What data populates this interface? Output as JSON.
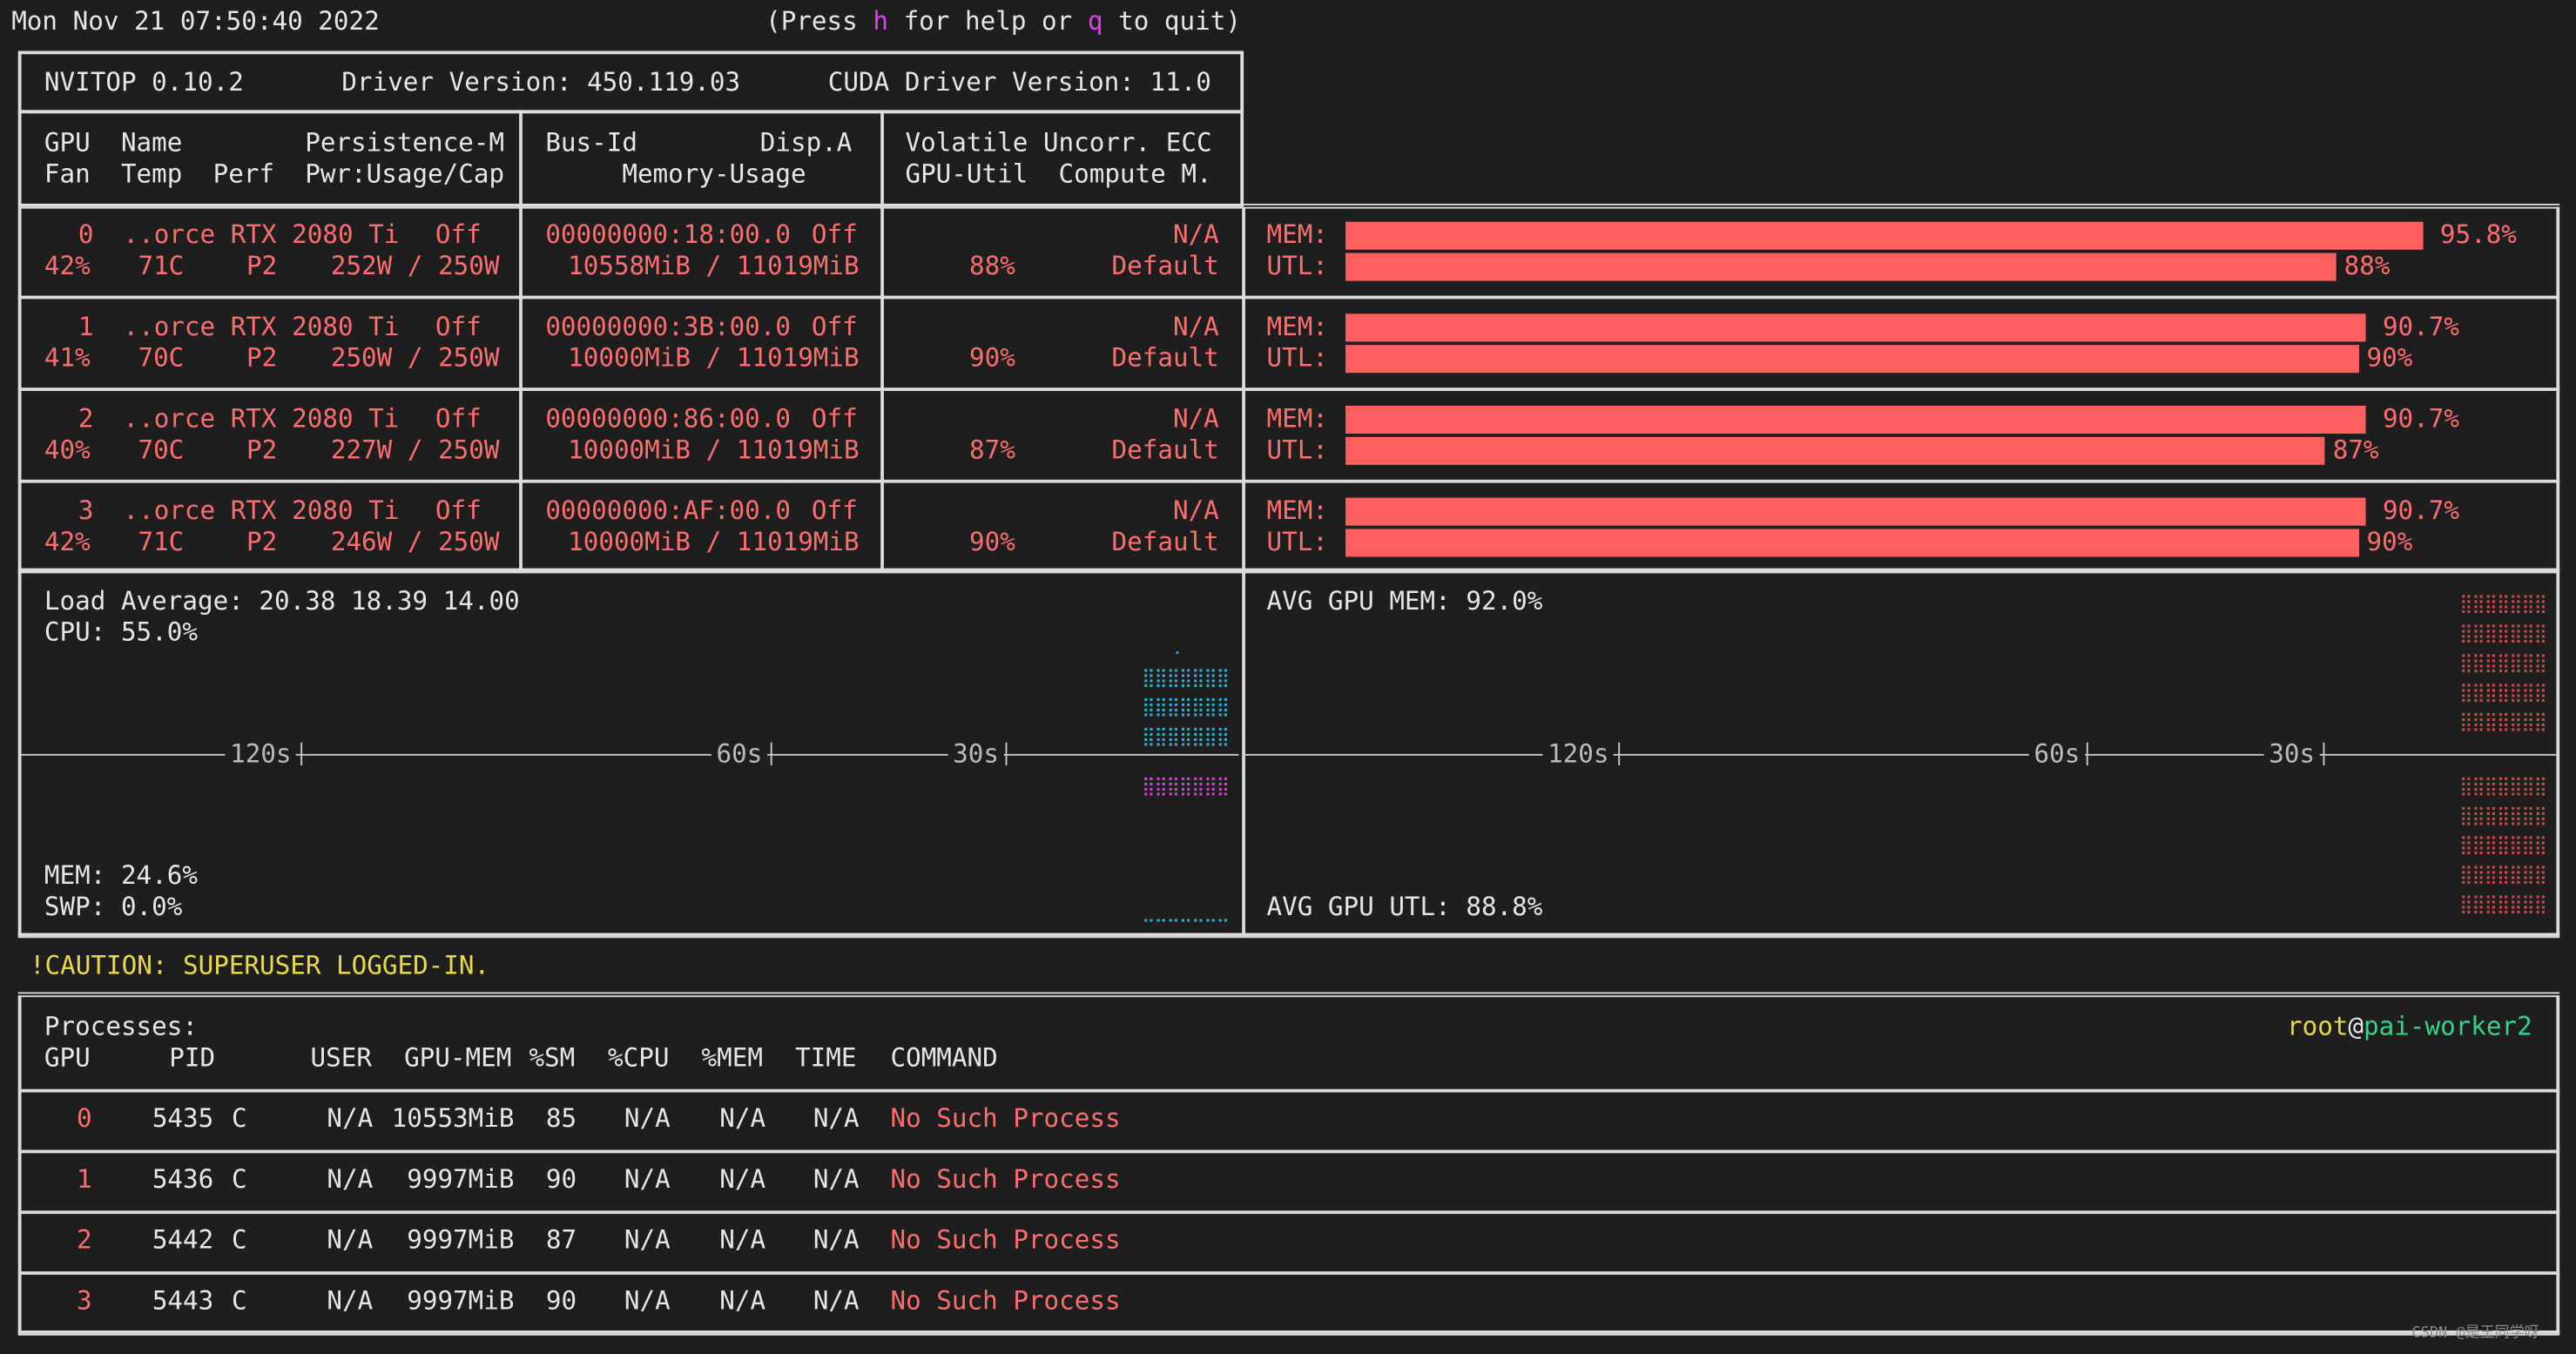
{
  "header": {
    "datetime": "Mon Nov 21 07:50:40 2022",
    "help_prefix": "(Press ",
    "help_key_h": "h",
    "help_mid": " for help or ",
    "help_key_q": "q",
    "help_suffix": " to quit)"
  },
  "info": {
    "nvitop": "NVITOP 0.10.2",
    "driver": "Driver Version: 450.119.03",
    "cuda": "CUDA Driver Version: 11.0"
  },
  "columns": {
    "c1_r1": "GPU  Name        Persistence-M",
    "c1_r2": "Fan  Temp  Perf  Pwr:Usage/Cap",
    "c2_r1": "Bus-Id        Disp.A",
    "c2_r2": "     Memory-Usage",
    "c3_r1": "Volatile Uncorr. ECC",
    "c3_r2": "GPU-Util  Compute M."
  },
  "gpus": [
    {
      "id": "0",
      "name": "..orce RTX 2080 Ti",
      "persist": "Off",
      "fan": "42%",
      "temp": "71C",
      "perf": "P2",
      "pwr": "252W / 250W",
      "bus": "00000000:18:00.0",
      "disp": "Off",
      "mem": "10558MiB / 11019MiB",
      "ecc": "N/A",
      "util": "88%",
      "compute": "Default",
      "mem_label": "MEM:",
      "utl_label": "UTL:",
      "mem_pct": "95.8%",
      "utl_pct": "88%",
      "mem_frac": 0.958,
      "utl_frac": 0.88
    },
    {
      "id": "1",
      "name": "..orce RTX 2080 Ti",
      "persist": "Off",
      "fan": "41%",
      "temp": "70C",
      "perf": "P2",
      "pwr": "250W / 250W",
      "bus": "00000000:3B:00.0",
      "disp": "Off",
      "mem": "10000MiB / 11019MiB",
      "ecc": "N/A",
      "util": "90%",
      "compute": "Default",
      "mem_label": "MEM:",
      "utl_label": "UTL:",
      "mem_pct": "90.7%",
      "utl_pct": "90%",
      "mem_frac": 0.907,
      "utl_frac": 0.9
    },
    {
      "id": "2",
      "name": "..orce RTX 2080 Ti",
      "persist": "Off",
      "fan": "40%",
      "temp": "70C",
      "perf": "P2",
      "pwr": "227W / 250W",
      "bus": "00000000:86:00.0",
      "disp": "Off",
      "mem": "10000MiB / 11019MiB",
      "ecc": "N/A",
      "util": "87%",
      "compute": "Default",
      "mem_label": "MEM:",
      "utl_label": "UTL:",
      "mem_pct": "90.7%",
      "utl_pct": "87%",
      "mem_frac": 0.907,
      "utl_frac": 0.87
    },
    {
      "id": "3",
      "name": "..orce RTX 2080 Ti",
      "persist": "Off",
      "fan": "42%",
      "temp": "71C",
      "perf": "P2",
      "pwr": "246W / 250W",
      "bus": "00000000:AF:00.0",
      "disp": "Off",
      "mem": "10000MiB / 11019MiB",
      "ecc": "N/A",
      "util": "90%",
      "compute": "Default",
      "mem_label": "MEM:",
      "utl_label": "UTL:",
      "mem_pct": "90.7%",
      "utl_pct": "90%",
      "mem_frac": 0.907,
      "utl_frac": 0.9
    }
  ],
  "host": {
    "load": "Load Average: 20.38 18.39 14.00",
    "cpu": "CPU: 55.0%",
    "mem": "MEM: 24.6%",
    "swp": "SWP: 0.0%",
    "t120": "120s",
    "t60": "60s",
    "t30": "30s"
  },
  "gpu_avg": {
    "mem": "AVG GPU MEM: 92.0%",
    "utl": "AVG GPU UTL: 88.8%",
    "t120": "120s",
    "t60": "60s",
    "t30": "30s"
  },
  "caution": "!CAUTION: SUPERUSER LOGGED-IN.",
  "processes": {
    "title": "Processes:",
    "user": "root",
    "at": "@",
    "host": "pai-worker2",
    "headers": {
      "gpu": "GPU",
      "pid": "PID",
      "user": "USER",
      "gpumem": "GPU-MEM",
      "sm": "%SM",
      "cpu": "%CPU",
      "mem": "%MEM",
      "time": "TIME",
      "command": "COMMAND"
    },
    "rows": [
      {
        "gpu": "0",
        "pid": "5435",
        "type": "C",
        "user": "N/A",
        "gpumem": "10553MiB",
        "sm": "85",
        "cpu": "N/A",
        "mem": "N/A",
        "time": "N/A",
        "command": "No Such Process"
      },
      {
        "gpu": "1",
        "pid": "5436",
        "type": "C",
        "user": "N/A",
        "gpumem": "9997MiB",
        "sm": "90",
        "cpu": "N/A",
        "mem": "N/A",
        "time": "N/A",
        "command": "No Such Process"
      },
      {
        "gpu": "2",
        "pid": "5442",
        "type": "C",
        "user": "N/A",
        "gpumem": "9997MiB",
        "sm": "87",
        "cpu": "N/A",
        "mem": "N/A",
        "time": "N/A",
        "command": "No Such Process"
      },
      {
        "gpu": "3",
        "pid": "5443",
        "type": "C",
        "user": "N/A",
        "gpumem": "9997MiB",
        "sm": "90",
        "cpu": "N/A",
        "mem": "N/A",
        "time": "N/A",
        "command": "No Such Process"
      }
    ]
  },
  "watermark": "CSDN @是王同学呀",
  "colors": {
    "bar": "#ff5f5f",
    "caution": "#e8d94a",
    "host": "#35d38a",
    "key": "#e040f0",
    "cpu_dots": "#3aa8c8",
    "mem_dots": "#d040d0",
    "gpu_dots": "#c84a4a"
  }
}
